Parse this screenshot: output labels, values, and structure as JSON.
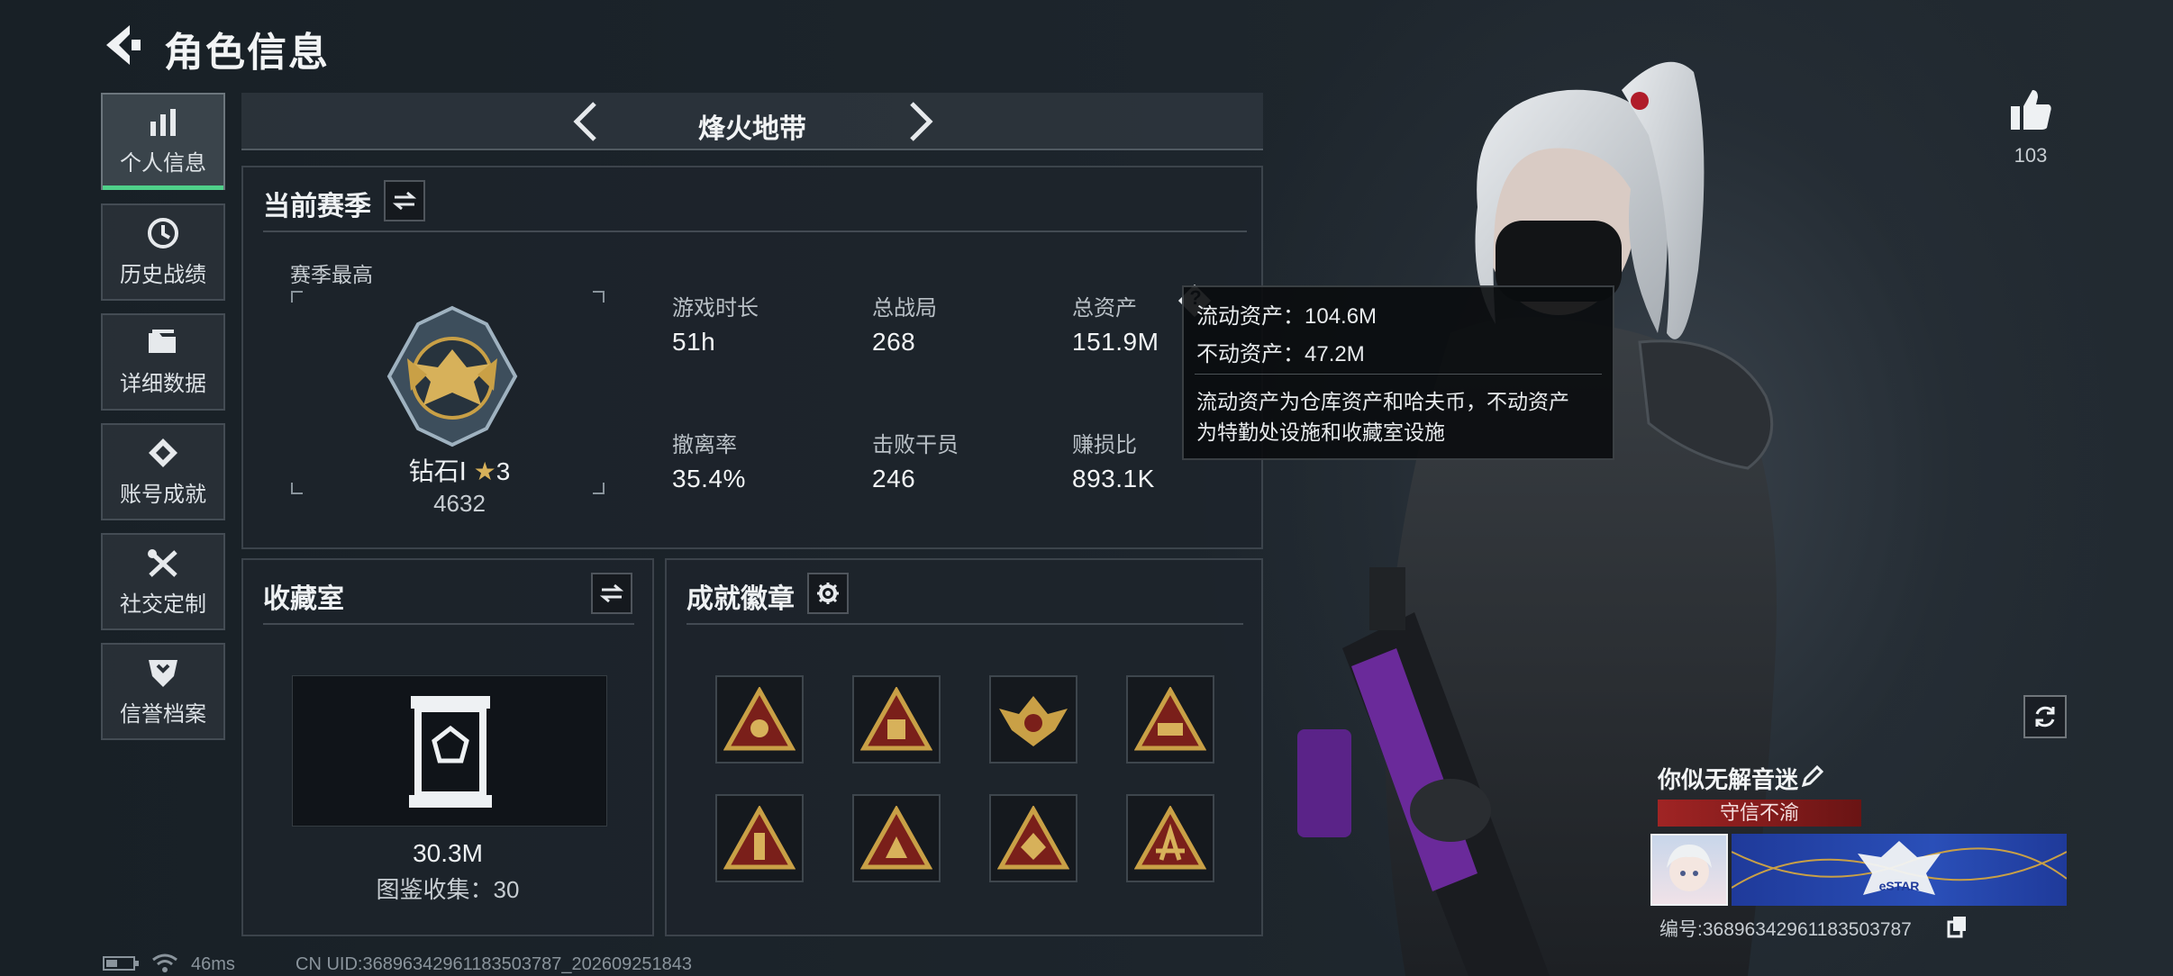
{
  "header": {
    "title": "角色信息"
  },
  "nav": {
    "items": [
      {
        "label": "个人信息",
        "icon": "bar-chart-icon",
        "active": true
      },
      {
        "label": "历史战绩",
        "icon": "history-clock-icon"
      },
      {
        "label": "详细数据",
        "icon": "folder-icon"
      },
      {
        "label": "账号成就",
        "icon": "achievement-icon"
      },
      {
        "label": "社交定制",
        "icon": "tools-icon"
      },
      {
        "label": "信誉档案",
        "icon": "shield-icon"
      }
    ]
  },
  "mode": {
    "name": "烽火地带"
  },
  "season": {
    "title": "当前赛季",
    "best_label": "赛季最高",
    "rank_name": "钻石Ⅰ",
    "rank_stars": "3",
    "rank_points": "4632",
    "stats": [
      {
        "label": "游戏时长",
        "value": "51h"
      },
      {
        "label": "总战局",
        "value": "268"
      },
      {
        "label": "总资产",
        "value": "151.9M"
      },
      {
        "label": "撤离率",
        "value": "35.4%"
      },
      {
        "label": "击败干员",
        "value": "246"
      },
      {
        "label": "赚损比",
        "value": "893.1K"
      }
    ]
  },
  "tooltip": {
    "liquid": "流动资产：104.6M",
    "fixed": "不动资产：47.2M",
    "desc_line1": "流动资产为仓库资产和哈夫币，不动资产",
    "desc_line2": "为特勤处设施和收藏室设施"
  },
  "collection": {
    "title": "收藏室",
    "value": "30.3M",
    "catalog": "图鉴收集：30"
  },
  "badges": {
    "title": "成就徽章",
    "items": [
      "badge-1",
      "badge-2",
      "badge-3",
      "badge-4",
      "badge-5",
      "badge-6",
      "badge-7",
      "badge-8"
    ]
  },
  "likes": {
    "count": "103"
  },
  "player": {
    "name": "你似无解音迷",
    "reputation": "守信不渝",
    "banner_text": "eSTAR",
    "id_text": "编号:3689634296118350378​7"
  },
  "status": {
    "ping": "46ms",
    "uid": "CN UID:3689634296118350378​7_202609251843"
  },
  "colors": {
    "accent_green": "#4fd08a",
    "reputation_red": "#8a1c1c",
    "gold": "#c9a046",
    "banner_blue": "#2a4fb8"
  }
}
